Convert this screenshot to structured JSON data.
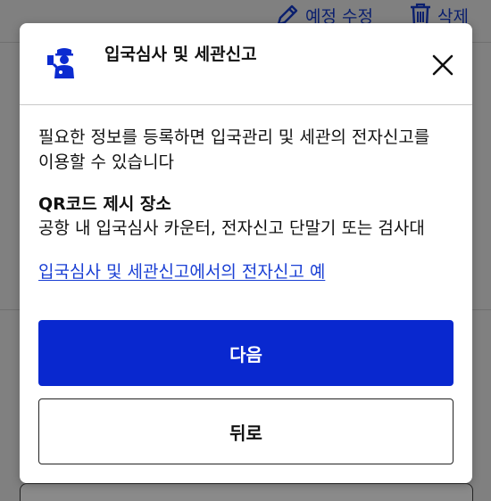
{
  "background": {
    "edit_label": "예정 수정",
    "delete_label": "삭제"
  },
  "modal": {
    "title": "입국심사 및 세관신고",
    "intro_line1": "필요한 정보를 등록하면 입국관리 및 세관의 전자신고를",
    "intro_line2": "이용할 수 있습니다",
    "qr_title": "QR코드 제시 장소",
    "qr_desc": "공항 내 입국심사 카운터, 전자신고 단말기 또는 검사대",
    "example_link": "입국심사 및 세관신고에서의 전자신고 예",
    "next_label": "다음",
    "back_label": "뒤로"
  },
  "colors": {
    "primary": "#0928cf",
    "link": "#1a3fd4",
    "icon": "#0b2bd0",
    "overlay": "#808080"
  }
}
